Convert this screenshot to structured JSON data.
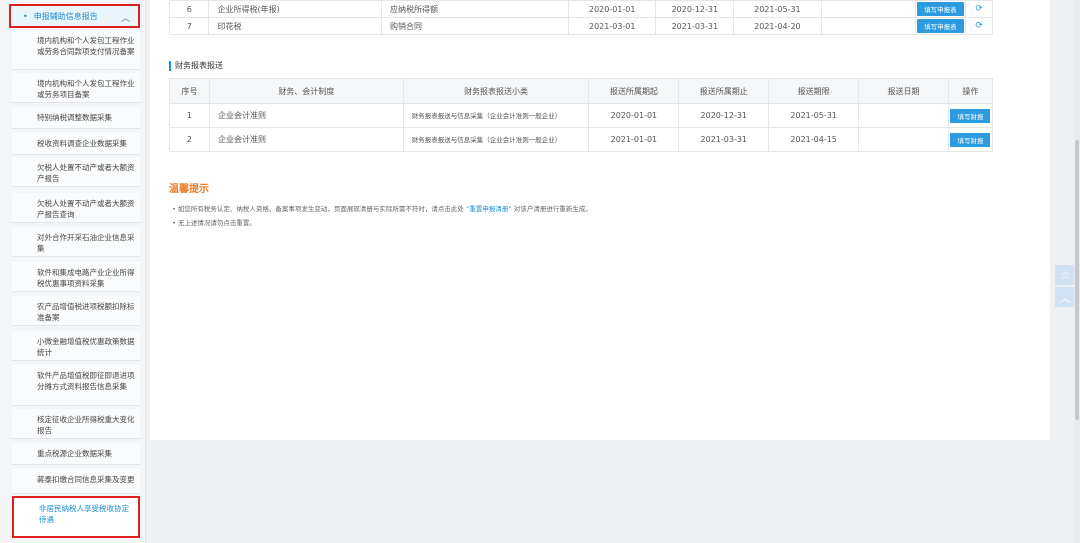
{
  "sidebar": {
    "header": "申报辅助信息报告",
    "items": [
      "境内机构和个人发包工程作业或劳务合同款项支付情况备案",
      "境内机构和个人发包工程作业或劳务项目备案",
      "特别纳税调整数据采集",
      "税收资料调查企业数据采集",
      "欠税人处置不动产或者大额资产报告",
      "欠税人处置不动产或者大额资产报告查询",
      "对外合作开采石油企业信息采集",
      "软件和集成电路产业企业所得税优惠事项资料采集",
      "农产品增值税进项税额扣除标准备案",
      "小微金融增值税优惠政策数据统计",
      "软件产品增值税即征即退进项分摊方式资料报告信息采集",
      "核定征收企业所得税重大变化报告",
      "重点税源企业数据采集",
      "蔣泰扣缴合同信息采集及变更",
      "非居民纳税人享受税收协定待遇"
    ]
  },
  "top_table": {
    "rows": [
      {
        "no": "6",
        "tax": "企业所得税(年报)",
        "item": "应纳税所得额",
        "start": "2020-01-01",
        "end": "2020-12-31",
        "deadline": "2021-05-31",
        "date": "",
        "action": "填写申报表"
      },
      {
        "no": "7",
        "tax": "印花税",
        "item": "购销合同",
        "start": "2021-03-01",
        "end": "2021-03-31",
        "deadline": "2021-04-20",
        "date": "",
        "action": "填写申报表"
      }
    ]
  },
  "financial": {
    "title": "财务报表报送",
    "headers": [
      "序号",
      "财务、会计制度",
      "财务报表报送小类",
      "报送所属期起",
      "报送所属期止",
      "报送期限",
      "报送日期",
      "操作"
    ],
    "rows": [
      {
        "no": "1",
        "system": "企业会计准则",
        "category": "财务报表报送与信息采集（企业会计准则一般企业）",
        "start": "2020-01-01",
        "end": "2020-12-31",
        "deadline": "2021-05-31",
        "date": "",
        "action": "填写财报"
      },
      {
        "no": "2",
        "system": "企业会计准则",
        "category": "财务报表报送与信息采集（企业会计准则一般企业）",
        "start": "2021-01-01",
        "end": "2021-03-31",
        "deadline": "2021-04-15",
        "date": "",
        "action": "填写财报"
      }
    ]
  },
  "tips": {
    "title": "温馨提示",
    "line1_a": "• 如您所有税务认定、纳税人资格、备案事项发生变动，页面展现清册与实际所需不符时，请点击此处",
    "line1_link": "重置申报清册",
    "line1_b": "对该户清册进行重新生成。",
    "line2": "• 无上述情况请勿点击重置。"
  },
  "icons": {
    "refresh": "refresh-icon",
    "star": "star-icon",
    "up": "chevron-up-icon"
  }
}
